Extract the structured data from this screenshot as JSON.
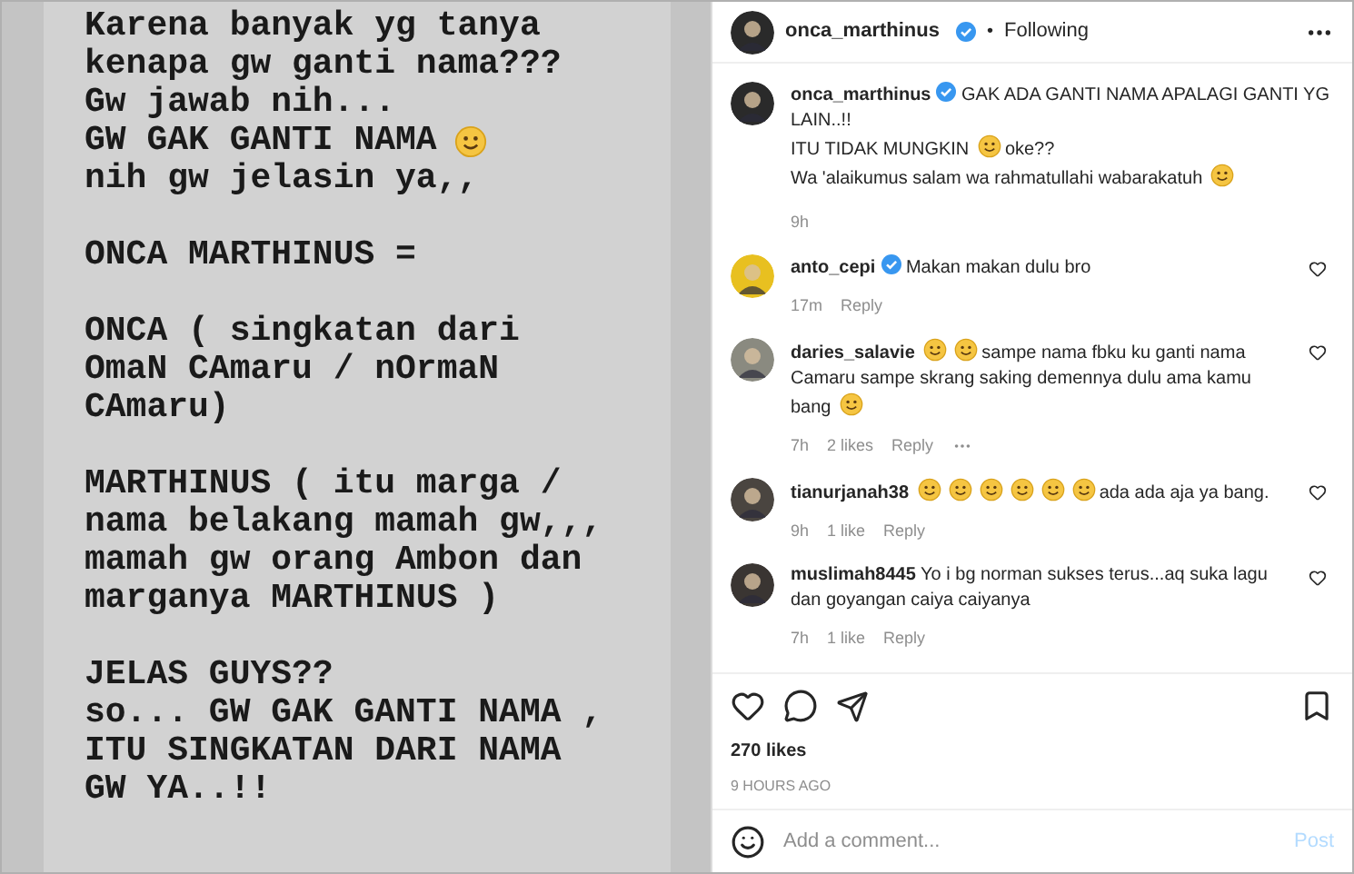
{
  "story": {
    "paragraphs": [
      [
        {
          "text": "Karena banyak yg tanya"
        },
        {
          "text": "kenapa gw ganti nama???"
        },
        {
          "text": "Gw jawab nih..."
        },
        {
          "text": "GW GAK GANTI NAMA",
          "emoji": true
        },
        {
          "text": "nih gw jelasin ya,,"
        }
      ],
      [
        {
          "text": "ONCA MARTHINUS ="
        }
      ],
      [
        {
          "text": "ONCA ( singkatan dari"
        },
        {
          "text": "OmaN CAmaru / nOrmaN"
        },
        {
          "text": "CAmaru)"
        }
      ],
      [
        {
          "text": "MARTHINUS ( itu marga /"
        },
        {
          "text": "nama belakang mamah gw,,,"
        },
        {
          "text": "mamah gw orang Ambon dan"
        },
        {
          "text": "marganya MARTHINUS )"
        }
      ],
      [
        {
          "text": "JELAS GUYS??"
        },
        {
          "text": "so... GW GAK GANTI NAMA ,"
        },
        {
          "text": "ITU SINGKATAN DARI NAMA"
        },
        {
          "text": "GW YA..!!"
        }
      ]
    ]
  },
  "header": {
    "username": "onca_marthinus",
    "verified": true,
    "separator": "•",
    "follow": "Following"
  },
  "caption": {
    "username": "onca_marthinus",
    "verified": true,
    "lines": [
      [
        {
          "kind": "text",
          "text": "GAK ADA GANTI NAMA APALAGI GANTI YG LAIN..!!"
        }
      ],
      [
        {
          "kind": "text",
          "text": "ITU TIDAK MUNGKIN"
        },
        {
          "kind": "emoji"
        },
        {
          "kind": "text",
          "text": "oke??"
        }
      ],
      [
        {
          "kind": "text",
          "text": "Wa 'alaikumus salam wa rahmatullahi wabarakatuh"
        },
        {
          "kind": "emoji"
        }
      ]
    ],
    "time": "9h"
  },
  "comments": [
    {
      "username": "anto_cepi",
      "verified": true,
      "parts": [
        {
          "kind": "text",
          "text": "Makan makan dulu bro"
        }
      ],
      "time": "17m",
      "reply": "Reply",
      "more": false
    },
    {
      "username": "daries_salavie",
      "verified": false,
      "parts": [
        {
          "kind": "emoji"
        },
        {
          "kind": "emoji"
        },
        {
          "kind": "text",
          "text": "sampe nama fbku ku ganti nama Camaru sampe skrang saking demennya dulu ama kamu bang"
        },
        {
          "kind": "emoji"
        }
      ],
      "time": "7h",
      "likes": "2 likes",
      "reply": "Reply",
      "more": true
    },
    {
      "username": "tianurjanah38",
      "verified": false,
      "parts": [
        {
          "kind": "emoji"
        },
        {
          "kind": "emoji"
        },
        {
          "kind": "emoji"
        },
        {
          "kind": "emoji"
        },
        {
          "kind": "emoji"
        },
        {
          "kind": "emoji"
        },
        {
          "kind": "text",
          "text": "ada ada aja ya bang."
        }
      ],
      "time": "9h",
      "likes": "1 like",
      "reply": "Reply",
      "more": false
    },
    {
      "username": "muslimah8445",
      "verified": false,
      "parts": [
        {
          "kind": "text",
          "text": "Yo i bg norman sukses terus...aq suka lagu dan goyangan caiya caiyanya"
        }
      ],
      "time": "7h",
      "likes": "1 like",
      "reply": "Reply",
      "more": false
    }
  ],
  "likes": "270 likes",
  "posted": "9 HOURS AGO",
  "comment_box": {
    "placeholder": "Add a comment...",
    "post": "Post",
    "disabled": true
  }
}
